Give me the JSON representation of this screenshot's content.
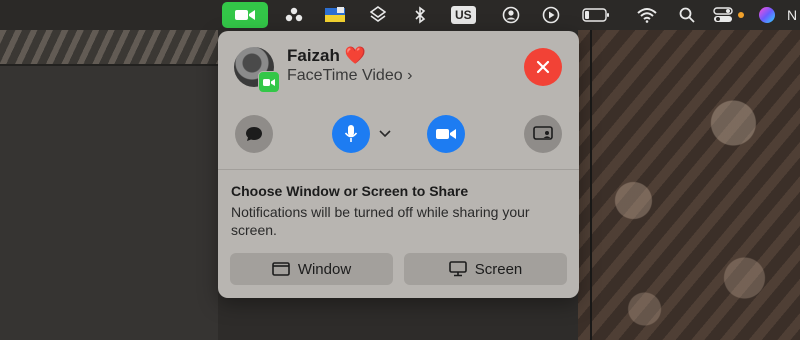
{
  "menubar": {
    "items": [
      {
        "name": "facetime-video-icon"
      },
      {
        "name": "people-icon"
      },
      {
        "name": "flag-icon"
      },
      {
        "name": "layers-icon"
      },
      {
        "name": "bluetooth-icon"
      },
      {
        "name": "keyboard-layout",
        "label": "US"
      },
      {
        "name": "user-circle-icon"
      },
      {
        "name": "play-circle-icon"
      },
      {
        "name": "battery-icon"
      },
      {
        "name": "wifi-icon"
      },
      {
        "name": "search-icon"
      },
      {
        "name": "control-center-icon"
      },
      {
        "name": "siri-icon"
      }
    ],
    "keyboard_label": "US",
    "accent_color": "#33c748"
  },
  "call": {
    "contact_name": "Faizah",
    "heart": "❤️",
    "call_type": "FaceTime Video",
    "chevron": "›"
  },
  "controls": {
    "items": [
      "message",
      "microphone",
      "camera",
      "share-screen"
    ]
  },
  "share": {
    "title": "Choose Window or Screen to Share",
    "description": "Notifications will be turned off while sharing your screen.",
    "window_label": "Window",
    "screen_label": "Screen"
  },
  "colors": {
    "end_call": "#f24236",
    "active_blue": "#1d7cf2",
    "panel": "#b8b5b1"
  }
}
